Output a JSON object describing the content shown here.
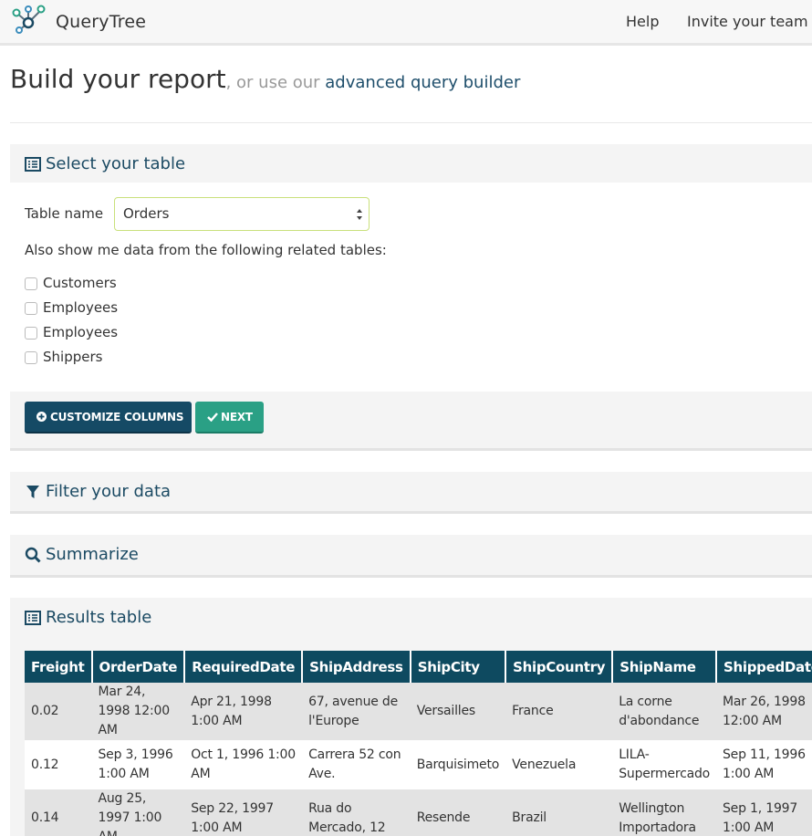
{
  "app": {
    "brand": "QueryTree"
  },
  "nav": {
    "help": "Help",
    "invite": "Invite your team"
  },
  "heading": {
    "title": "Build your report",
    "sub": ", or use our ",
    "link": "advanced query builder"
  },
  "select_panel": {
    "title": "Select your table",
    "table_label": "Table name",
    "table_value": "Orders",
    "related_label": "Also show me data from the following related tables:",
    "related": [
      "Customers",
      "Employees",
      "Employees",
      "Shippers"
    ],
    "customize_button": "CUSTOMIZE COLUMNS",
    "next_button": "NEXT"
  },
  "filter_panel": {
    "title": "Filter your data"
  },
  "summarize_panel": {
    "title": "Summarize"
  },
  "results_panel": {
    "title": "Results table",
    "columns": [
      "Freight",
      "OrderDate",
      "RequiredDate",
      "ShipAddress",
      "ShipCity",
      "ShipCountry",
      "ShipName",
      "ShippedDate"
    ],
    "rows": [
      [
        "0.02",
        "Mar 24, 1998 12:00 AM",
        "Apr 21, 1998 1:00 AM",
        "67, avenue de l'Europe",
        "Versailles",
        "France",
        "La corne d'abondance",
        "Mar 26, 1998 12:00 AM"
      ],
      [
        "0.12",
        "Sep 3, 1996 1:00 AM",
        "Oct 1, 1996 1:00 AM",
        "Carrera 52 con Ave.",
        "Barquisimeto",
        "Venezuela",
        "LILA-Supermercado",
        "Sep 11, 1996 1:00 AM"
      ],
      [
        "0.14",
        "Aug 25, 1997 1:00 AM",
        "Sep 22, 1997 1:00 AM",
        "Rua do Mercado, 12",
        "Resende",
        "Brazil",
        "Wellington Importadora",
        "Sep 1, 1997 1:00 AM"
      ]
    ]
  },
  "colors": {
    "primary": "#154a65",
    "success": "#2aa085",
    "header": "#0e4a60",
    "link": "#1e4e6b"
  }
}
